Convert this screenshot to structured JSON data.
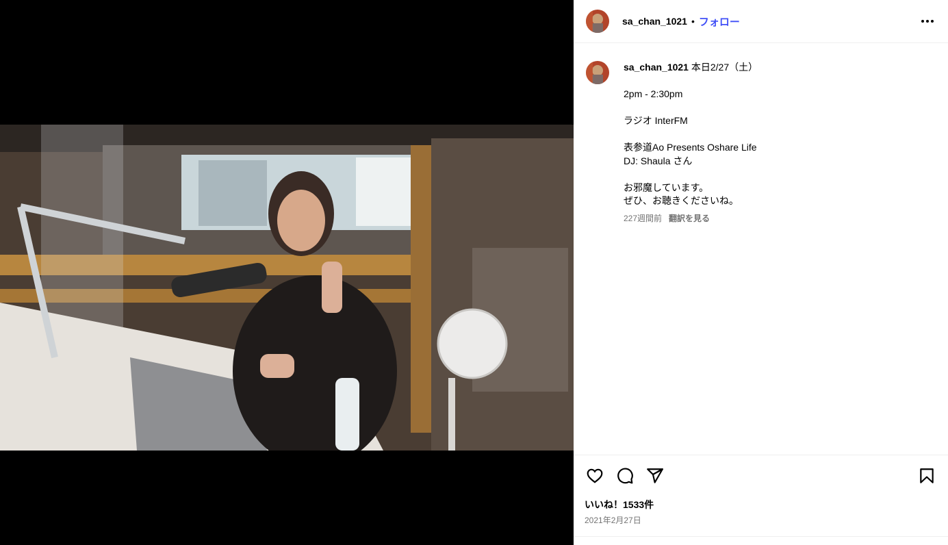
{
  "post": {
    "username": "sa_chan_1021",
    "separator": "•",
    "follow_label": "フォロー",
    "more_icon": "more-horizontal-icon"
  },
  "caption": {
    "username": "sa_chan_1021",
    "text": " 本日2/27（土）\n\n2pm - 2:30pm\n\nラジオ InterFM\n\n表参道Ao Presents Oshare Life\nDJ: Shaula さん\n\nお邪魔しています。\nぜひ、お聴きくださいね。",
    "age": "227週間前",
    "translate_label": "翻訳を見る"
  },
  "actions": {
    "like_icon": "heart-icon",
    "comment_icon": "comment-icon",
    "share_icon": "send-icon",
    "save_icon": "bookmark-icon"
  },
  "likes_text": "いいね！1533件",
  "date_text": "2021年2月27日",
  "colors": {
    "link": "#4150f7",
    "muted": "#737373",
    "divider": "#efefef"
  }
}
